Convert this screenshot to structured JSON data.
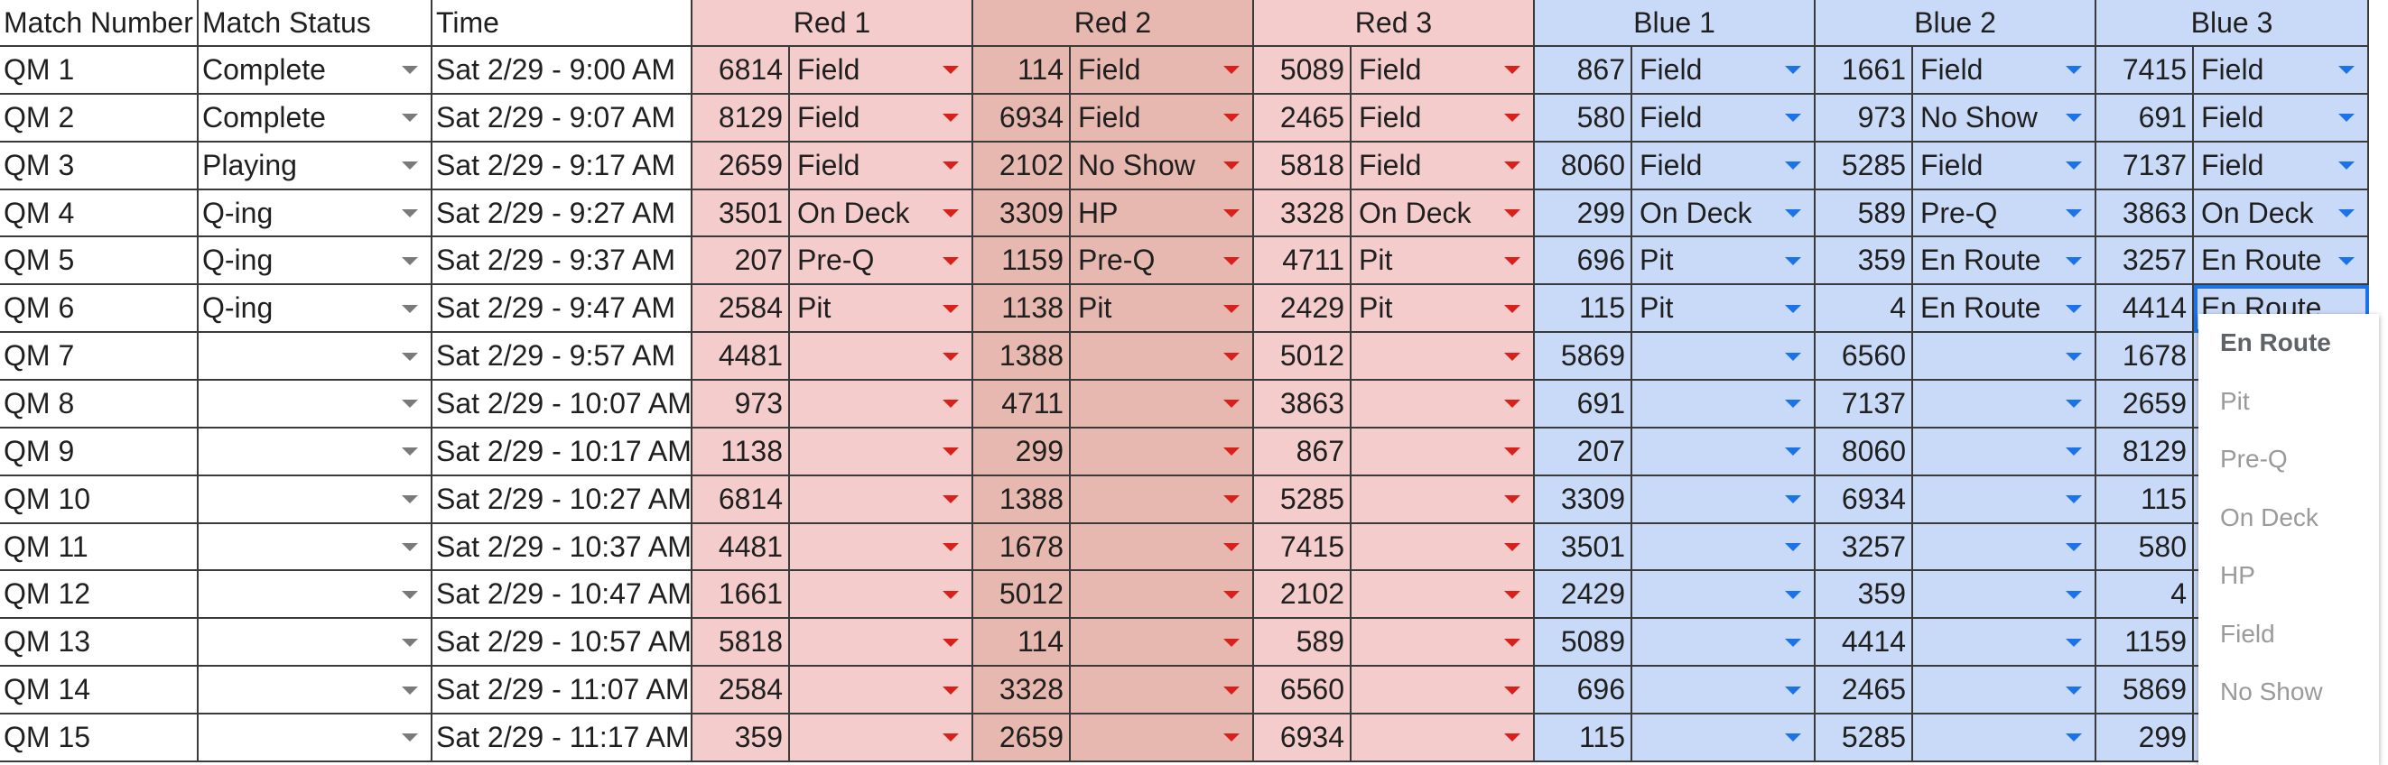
{
  "headers": [
    "Match Number",
    "Match Status",
    "Time",
    "Red 1",
    "Red 2",
    "Red 3",
    "Blue 1",
    "Blue 2",
    "Blue 3"
  ],
  "rows": [
    {
      "match": "QM 1",
      "status": "Complete",
      "time": "Sat 2/29 - 9:00 AM",
      "teams": [
        {
          "num": "6814",
          "status": "Field"
        },
        {
          "num": "114",
          "status": "Field"
        },
        {
          "num": "5089",
          "status": "Field"
        },
        {
          "num": "867",
          "status": "Field"
        },
        {
          "num": "1661",
          "status": "Field"
        },
        {
          "num": "7415",
          "status": "Field"
        }
      ]
    },
    {
      "match": "QM 2",
      "status": "Complete",
      "time": "Sat 2/29 - 9:07 AM",
      "teams": [
        {
          "num": "8129",
          "status": "Field"
        },
        {
          "num": "6934",
          "status": "Field"
        },
        {
          "num": "2465",
          "status": "Field"
        },
        {
          "num": "580",
          "status": "Field"
        },
        {
          "num": "973",
          "status": "No Show"
        },
        {
          "num": "691",
          "status": "Field"
        }
      ]
    },
    {
      "match": "QM 3",
      "status": "Playing",
      "time": "Sat 2/29 - 9:17 AM",
      "teams": [
        {
          "num": "2659",
          "status": "Field"
        },
        {
          "num": "2102",
          "status": "No Show"
        },
        {
          "num": "5818",
          "status": "Field"
        },
        {
          "num": "8060",
          "status": "Field"
        },
        {
          "num": "5285",
          "status": "Field"
        },
        {
          "num": "7137",
          "status": "Field"
        }
      ]
    },
    {
      "match": "QM 4",
      "status": "Q-ing",
      "time": "Sat 2/29 - 9:27 AM",
      "teams": [
        {
          "num": "3501",
          "status": "On Deck"
        },
        {
          "num": "3309",
          "status": "HP"
        },
        {
          "num": "3328",
          "status": "On Deck"
        },
        {
          "num": "299",
          "status": "On Deck"
        },
        {
          "num": "589",
          "status": "Pre-Q"
        },
        {
          "num": "3863",
          "status": "On Deck"
        }
      ]
    },
    {
      "match": "QM 5",
      "status": "Q-ing",
      "time": "Sat 2/29 - 9:37 AM",
      "teams": [
        {
          "num": "207",
          "status": "Pre-Q"
        },
        {
          "num": "1159",
          "status": "Pre-Q"
        },
        {
          "num": "4711",
          "status": "Pit"
        },
        {
          "num": "696",
          "status": "Pit"
        },
        {
          "num": "359",
          "status": "En Route"
        },
        {
          "num": "3257",
          "status": "En Route"
        }
      ]
    },
    {
      "match": "QM 6",
      "status": "Q-ing",
      "time": "Sat 2/29 - 9:47 AM",
      "teams": [
        {
          "num": "2584",
          "status": "Pit"
        },
        {
          "num": "1138",
          "status": "Pit"
        },
        {
          "num": "2429",
          "status": "Pit"
        },
        {
          "num": "115",
          "status": "Pit"
        },
        {
          "num": "4",
          "status": "En Route"
        },
        {
          "num": "4414",
          "status": "En Route"
        }
      ]
    },
    {
      "match": "QM 7",
      "status": "",
      "time": "Sat 2/29 - 9:57 AM",
      "teams": [
        {
          "num": "4481",
          "status": ""
        },
        {
          "num": "1388",
          "status": ""
        },
        {
          "num": "5012",
          "status": ""
        },
        {
          "num": "5869",
          "status": ""
        },
        {
          "num": "6560",
          "status": ""
        },
        {
          "num": "1678",
          "status": ""
        }
      ]
    },
    {
      "match": "QM 8",
      "status": "",
      "time": "Sat 2/29 - 10:07 AM",
      "teams": [
        {
          "num": "973",
          "status": ""
        },
        {
          "num": "4711",
          "status": ""
        },
        {
          "num": "3863",
          "status": ""
        },
        {
          "num": "691",
          "status": ""
        },
        {
          "num": "7137",
          "status": ""
        },
        {
          "num": "2659",
          "status": ""
        }
      ]
    },
    {
      "match": "QM 9",
      "status": "",
      "time": "Sat 2/29 - 10:17 AM",
      "teams": [
        {
          "num": "1138",
          "status": ""
        },
        {
          "num": "299",
          "status": ""
        },
        {
          "num": "867",
          "status": ""
        },
        {
          "num": "207",
          "status": ""
        },
        {
          "num": "8060",
          "status": ""
        },
        {
          "num": "8129",
          "status": ""
        }
      ]
    },
    {
      "match": "QM 10",
      "status": "",
      "time": "Sat 2/29 - 10:27 AM",
      "teams": [
        {
          "num": "6814",
          "status": ""
        },
        {
          "num": "1388",
          "status": ""
        },
        {
          "num": "5285",
          "status": ""
        },
        {
          "num": "3309",
          "status": ""
        },
        {
          "num": "6934",
          "status": ""
        },
        {
          "num": "115",
          "status": ""
        }
      ]
    },
    {
      "match": "QM 11",
      "status": "",
      "time": "Sat 2/29 - 10:37 AM",
      "teams": [
        {
          "num": "4481",
          "status": ""
        },
        {
          "num": "1678",
          "status": ""
        },
        {
          "num": "7415",
          "status": ""
        },
        {
          "num": "3501",
          "status": ""
        },
        {
          "num": "3257",
          "status": ""
        },
        {
          "num": "580",
          "status": ""
        }
      ]
    },
    {
      "match": "QM 12",
      "status": "",
      "time": "Sat 2/29 - 10:47 AM",
      "teams": [
        {
          "num": "1661",
          "status": ""
        },
        {
          "num": "5012",
          "status": ""
        },
        {
          "num": "2102",
          "status": ""
        },
        {
          "num": "2429",
          "status": ""
        },
        {
          "num": "359",
          "status": ""
        },
        {
          "num": "4",
          "status": ""
        }
      ]
    },
    {
      "match": "QM 13",
      "status": "",
      "time": "Sat 2/29 - 10:57 AM",
      "teams": [
        {
          "num": "5818",
          "status": ""
        },
        {
          "num": "114",
          "status": ""
        },
        {
          "num": "589",
          "status": ""
        },
        {
          "num": "5089",
          "status": ""
        },
        {
          "num": "4414",
          "status": ""
        },
        {
          "num": "1159",
          "status": ""
        }
      ]
    },
    {
      "match": "QM 14",
      "status": "",
      "time": "Sat 2/29 - 11:07 AM",
      "teams": [
        {
          "num": "2584",
          "status": ""
        },
        {
          "num": "3328",
          "status": ""
        },
        {
          "num": "6560",
          "status": ""
        },
        {
          "num": "696",
          "status": ""
        },
        {
          "num": "2465",
          "status": ""
        },
        {
          "num": "5869",
          "status": ""
        }
      ]
    },
    {
      "match": "QM 15",
      "status": "",
      "time": "Sat 2/29 - 11:17 AM",
      "teams": [
        {
          "num": "359",
          "status": ""
        },
        {
          "num": "2659",
          "status": ""
        },
        {
          "num": "6934",
          "status": ""
        },
        {
          "num": "115",
          "status": ""
        },
        {
          "num": "5285",
          "status": ""
        },
        {
          "num": "299",
          "status": ""
        }
      ]
    }
  ],
  "dropdown_menu": {
    "selected": "En Route",
    "options": [
      "En Route",
      "Pit",
      "Pre-Q",
      "On Deck",
      "HP",
      "Field",
      "No Show"
    ]
  },
  "colors": {
    "red_fill": "#f4cccc",
    "red2_fill": "#e6b8af",
    "blue_fill": "#c9daf8",
    "red_arrow": "#d9201a",
    "blue_arrow": "#1a73e8",
    "selection": "#1a73e8"
  },
  "icons": {
    "dropdown": "chevron-down-icon"
  },
  "active_cell": {
    "row": 6,
    "column": "Blue 3 status"
  }
}
